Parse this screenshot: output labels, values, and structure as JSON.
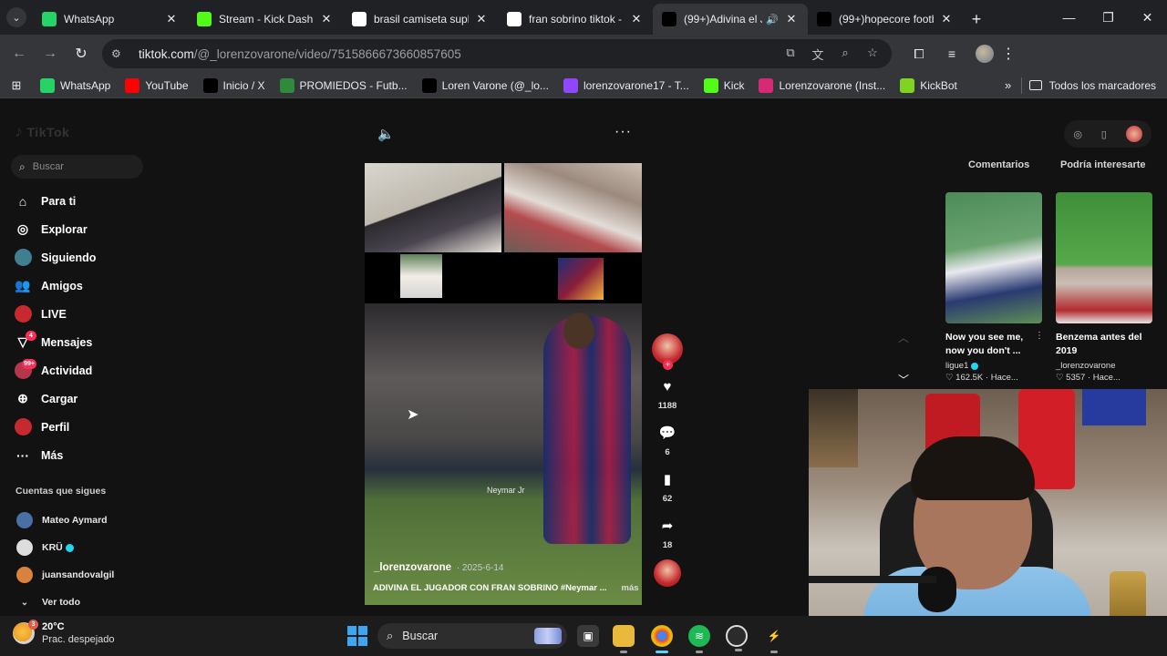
{
  "browser": {
    "tabs": [
      {
        "title": "WhatsApp",
        "favicon_color": "#25d366",
        "active": false
      },
      {
        "title": "Stream - Kick Dashbo",
        "favicon_color": "#53fc18",
        "active": false
      },
      {
        "title": "brasil camiseta suple",
        "favicon_color": "#ffffff",
        "active": false
      },
      {
        "title": "fran sobrino tiktok - ",
        "favicon_color": "#ffffff",
        "active": false
      },
      {
        "title": "(99+)Adivina el Ju",
        "favicon_color": "#000000",
        "active": true
      },
      {
        "title": "(99+)hopecore footb",
        "favicon_color": "#000000",
        "active": false
      }
    ],
    "url_host": "tiktok.com",
    "url_path": "/@_lorenzovarone/video/7515866673660857605",
    "bookmarks": [
      {
        "label": "WhatsApp",
        "color": "#25d366"
      },
      {
        "label": "YouTube",
        "color": "#ff0000"
      },
      {
        "label": "Inicio / X",
        "color": "#000000"
      },
      {
        "label": "PROMIEDOS - Futb...",
        "color": "#2e8b3a"
      },
      {
        "label": "Loren Varone (@_lo...",
        "color": "#000000"
      },
      {
        "label": "lorenzovarone17 - T...",
        "color": "#9146ff"
      },
      {
        "label": "Kick",
        "color": "#53fc18"
      },
      {
        "label": "Lorenzovarone (Inst...",
        "color": "#d62976"
      },
      {
        "label": "KickBot",
        "color": "#7fd321"
      }
    ],
    "all_bookmarks": "Todos los marcadores"
  },
  "tiktok": {
    "logo": "TikTok",
    "search_placeholder": "Buscar",
    "nav": [
      {
        "label": "Para ti",
        "icon": "home-icon"
      },
      {
        "label": "Explorar",
        "icon": "compass-icon"
      },
      {
        "label": "Siguiendo",
        "icon": "following-icon"
      },
      {
        "label": "Amigos",
        "icon": "friends-icon"
      },
      {
        "label": "LIVE",
        "icon": "live-icon"
      },
      {
        "label": "Mensajes",
        "icon": "messages-icon",
        "badge": "4"
      },
      {
        "label": "Actividad",
        "icon": "activity-icon",
        "badge": "99+"
      },
      {
        "label": "Cargar",
        "icon": "upload-icon"
      },
      {
        "label": "Perfil",
        "icon": "profile-icon"
      },
      {
        "label": "Más",
        "icon": "more-icon"
      }
    ],
    "following_header": "Cuentas que sigues",
    "following": [
      {
        "name": "Mateo Aymard",
        "verified": false,
        "color": "#4a6fa5"
      },
      {
        "name": "KRÜ",
        "verified": true,
        "color": "#dddddd"
      },
      {
        "name": "juansandovalgil",
        "verified": false,
        "color": "#d9823b"
      }
    ],
    "see_all": "Ver todo",
    "video": {
      "author": "_lorenzovarone",
      "date": "2025-6-14",
      "description": "ADIVINA EL JUGADOR CON FRAN SOBRINO #Neymar ...",
      "more": "más",
      "player_label": "Neymar Jr",
      "likes": "1188",
      "comments": "6",
      "saves": "62",
      "shares": "18"
    },
    "right_tabs": [
      "Comentarios",
      "Podría interesarte"
    ],
    "suggestions": [
      {
        "title": "Now you see me, now you don't ...",
        "author": "ligue1",
        "verified": true,
        "stats": "♡ 162.5K · Hace..."
      },
      {
        "title": "Benzema antes del 2019",
        "author": "_lorenzovarone",
        "verified": false,
        "stats": "♡ 5357 · Hace..."
      }
    ]
  },
  "taskbar": {
    "temperature": "20°C",
    "condition": "Prac. despejado",
    "weather_badge": "3",
    "search_label": "Buscar"
  }
}
